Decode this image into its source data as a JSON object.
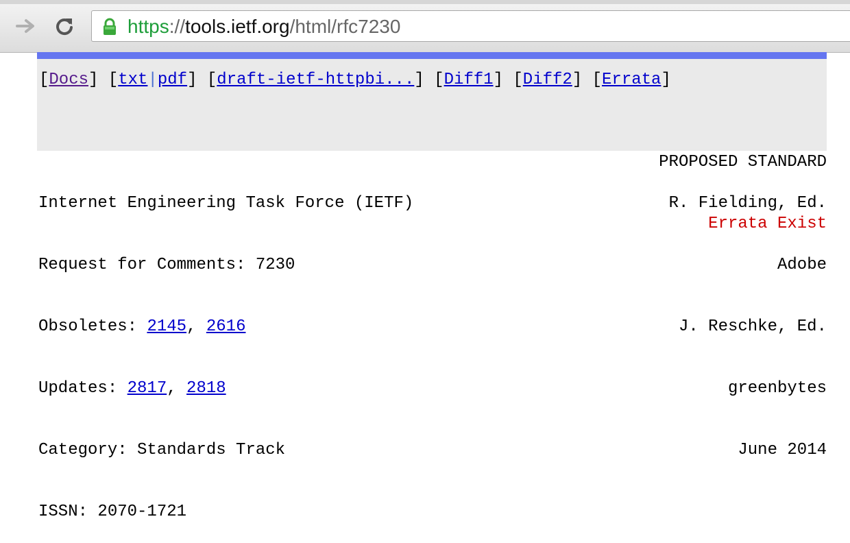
{
  "browser": {
    "url_scheme": "https",
    "url_sep": "://",
    "url_host": "tools.ietf.org",
    "url_path": "/html/rfc7230",
    "lock_color": "#3aa83a"
  },
  "nav": {
    "open": "[",
    "close": "]",
    "docs": "Docs",
    "txt": "txt",
    "pipe": "|",
    "pdf": "pdf",
    "draft": "draft-ietf-httpbi...",
    "diff1": "Diff1",
    "diff2": "Diff2",
    "errata": "Errata"
  },
  "status": {
    "standard": "PROPOSED STANDARD",
    "errata": "Errata Exist"
  },
  "meta_left": {
    "org": "Internet Engineering Task Force (IETF)",
    "rfc": "Request for Comments: 7230",
    "obsoletes_label": "Obsoletes: ",
    "obsoletes": [
      "2145",
      "2616"
    ],
    "updates_label": "Updates: ",
    "updates": [
      "2817",
      "2818"
    ],
    "category": "Category: Standards Track",
    "issn": "ISSN: 2070-1721",
    "comma": ", "
  },
  "meta_right": {
    "author1": "R. Fielding, Ed.",
    "affil1": "Adobe",
    "author2": "J. Reschke, Ed.",
    "affil2": "greenbytes",
    "date": "June 2014"
  },
  "colors": {
    "accent_bar": "#6475f0",
    "link": "#0000cc",
    "visited": "#551a8b",
    "errata": "#cc0000"
  }
}
